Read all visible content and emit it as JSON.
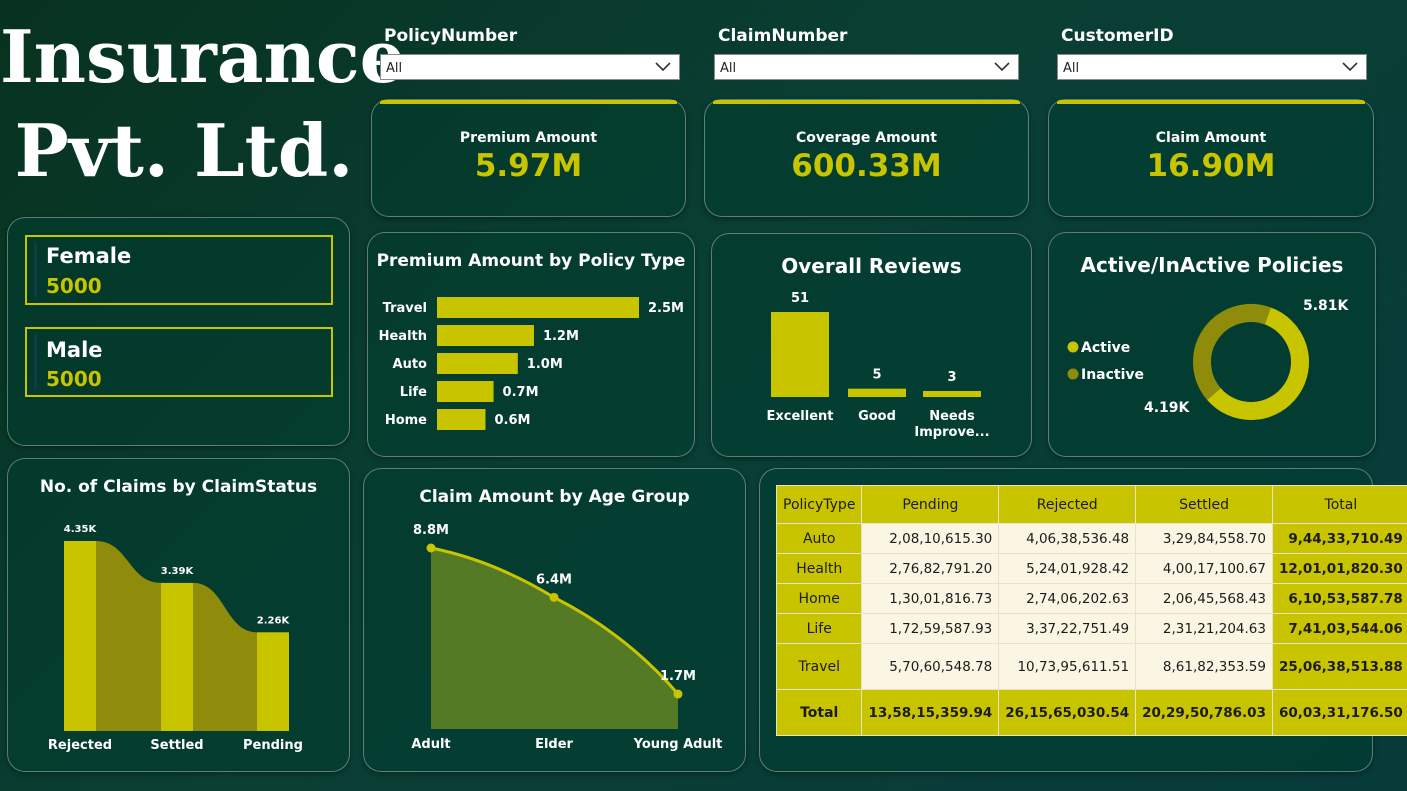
{
  "brand": {
    "line1": "Insurance",
    "line2": "Pvt. Ltd."
  },
  "slicers": [
    {
      "label": "PolicyNumber",
      "value": "All"
    },
    {
      "label": "ClaimNumber",
      "value": "All"
    },
    {
      "label": "CustomerID",
      "value": "All"
    }
  ],
  "kpis": [
    {
      "label": "Premium Amount",
      "value": "5.97M"
    },
    {
      "label": "Coverage Amount",
      "value": "600.33M"
    },
    {
      "label": "Claim Amount",
      "value": "16.90M"
    }
  ],
  "gender": [
    {
      "name": "Female",
      "count": "5000"
    },
    {
      "name": "Male",
      "count": "5000"
    }
  ],
  "colors": {
    "accent": "#c9c400",
    "accent_dark": "#8e8c0a",
    "area_fill": "#557a25",
    "background": "#083a2e"
  },
  "chart_data": [
    {
      "id": "premium_by_policy",
      "type": "bar",
      "orientation": "horizontal",
      "title": "Premium Amount by Policy Type",
      "categories": [
        "Travel",
        "Health",
        "Auto",
        "Life",
        "Home"
      ],
      "values": [
        2.5,
        1.2,
        1.0,
        0.7,
        0.6
      ],
      "labels": [
        "2.5M",
        "1.2M",
        "1.0M",
        "0.7M",
        "0.6M"
      ],
      "unit": "M"
    },
    {
      "id": "overall_reviews",
      "type": "bar",
      "title": "Overall Reviews",
      "categories": [
        "Excellent",
        "Good",
        "Needs Improve..."
      ],
      "values": [
        51,
        5,
        3
      ],
      "labels": [
        "51",
        "5",
        "3"
      ]
    },
    {
      "id": "active_inactive",
      "type": "pie",
      "donut": true,
      "title": "Active/InActive Policies",
      "categories": [
        "Active",
        "Inactive"
      ],
      "values": [
        5810,
        4190
      ],
      "labels": [
        "5.81K",
        "4.19K"
      ],
      "legend": "left"
    },
    {
      "id": "claims_by_status",
      "type": "bar",
      "title": "No. of Claims by ClaimStatus",
      "categories": [
        "Rejected",
        "Settled",
        "Pending"
      ],
      "values": [
        4350,
        3390,
        2260
      ],
      "labels": [
        "4.35K",
        "3.39K",
        "2.26K"
      ]
    },
    {
      "id": "claim_by_age",
      "type": "area",
      "title": "Claim Amount by Age Group",
      "categories": [
        "Adult",
        "Elder",
        "Young Adult"
      ],
      "values": [
        8.8,
        6.4,
        1.7
      ],
      "labels": [
        "8.8M",
        "6.4M",
        "1.7M"
      ]
    },
    {
      "id": "claims_matrix",
      "type": "table",
      "columns": [
        "PolicyType",
        "Pending",
        "Rejected",
        "Settled",
        "Total"
      ],
      "rows": [
        [
          "Auto",
          "2,08,10,615.30",
          "4,06,38,536.48",
          "3,29,84,558.70",
          "9,44,33,710.49"
        ],
        [
          "Health",
          "2,76,82,791.20",
          "5,24,01,928.42",
          "4,00,17,100.67",
          "12,01,01,820.30"
        ],
        [
          "Home",
          "1,30,01,816.73",
          "2,74,06,202.63",
          "2,06,45,568.43",
          "6,10,53,587.78"
        ],
        [
          "Life",
          "1,72,59,587.93",
          "3,37,22,751.49",
          "2,31,21,204.63",
          "7,41,03,544.06"
        ],
        [
          "Travel",
          "5,70,60,548.78",
          "10,73,95,611.51",
          "8,61,82,353.59",
          "25,06,38,513.88"
        ]
      ],
      "total": [
        "Total",
        "13,58,15,359.94",
        "26,15,65,030.54",
        "20,29,50,786.03",
        "60,03,31,176.50"
      ]
    }
  ]
}
